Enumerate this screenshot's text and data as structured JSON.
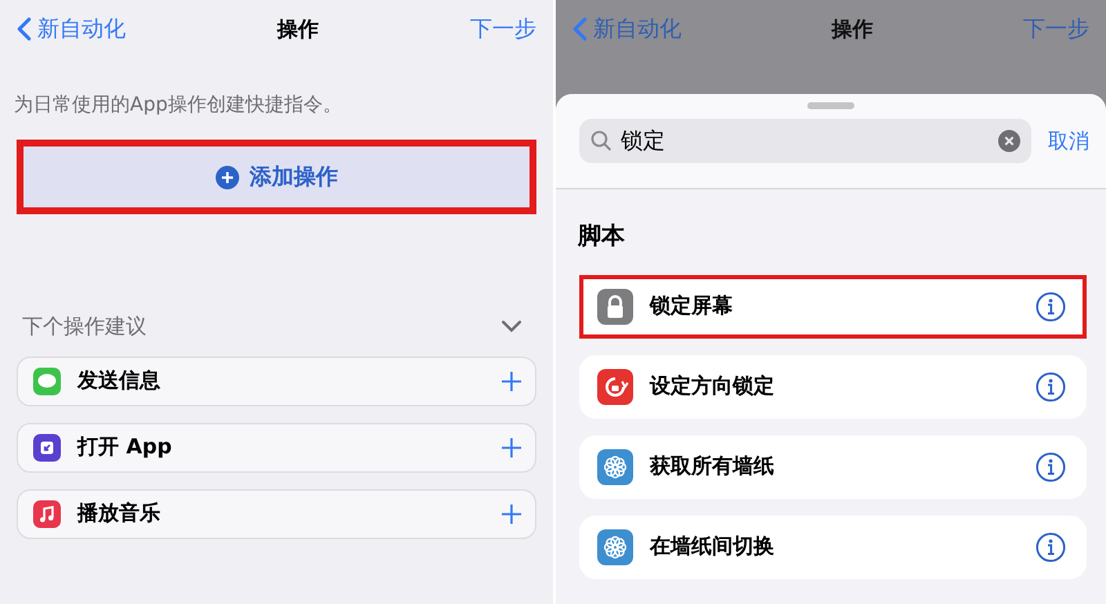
{
  "left": {
    "nav": {
      "back": "新自动化",
      "title": "操作",
      "next": "下一步"
    },
    "description": "为日常使用的App操作创建快捷指令。",
    "add_button": {
      "label": "添加操作",
      "highlighted": true
    },
    "suggestions": {
      "title": "下个操作建议",
      "expanded": true,
      "items": [
        {
          "kind": "message",
          "label": "发送信息"
        },
        {
          "kind": "open-app",
          "label": "打开 App"
        },
        {
          "kind": "music",
          "label": "播放音乐"
        }
      ]
    }
  },
  "right": {
    "nav": {
      "back": "新自动化",
      "title": "操作",
      "next": "下一步"
    },
    "search": {
      "value": "锁定",
      "cancel": "取消"
    },
    "section": "脚本",
    "results": [
      {
        "kind": "lock",
        "label": "锁定屏幕",
        "highlighted": true
      },
      {
        "kind": "orientation",
        "label": "设定方向锁定",
        "highlighted": false
      },
      {
        "kind": "wallpaper",
        "label": "获取所有墙纸",
        "highlighted": false
      },
      {
        "kind": "wallpaper",
        "label": "在墙纸间切换",
        "highlighted": false
      }
    ]
  }
}
